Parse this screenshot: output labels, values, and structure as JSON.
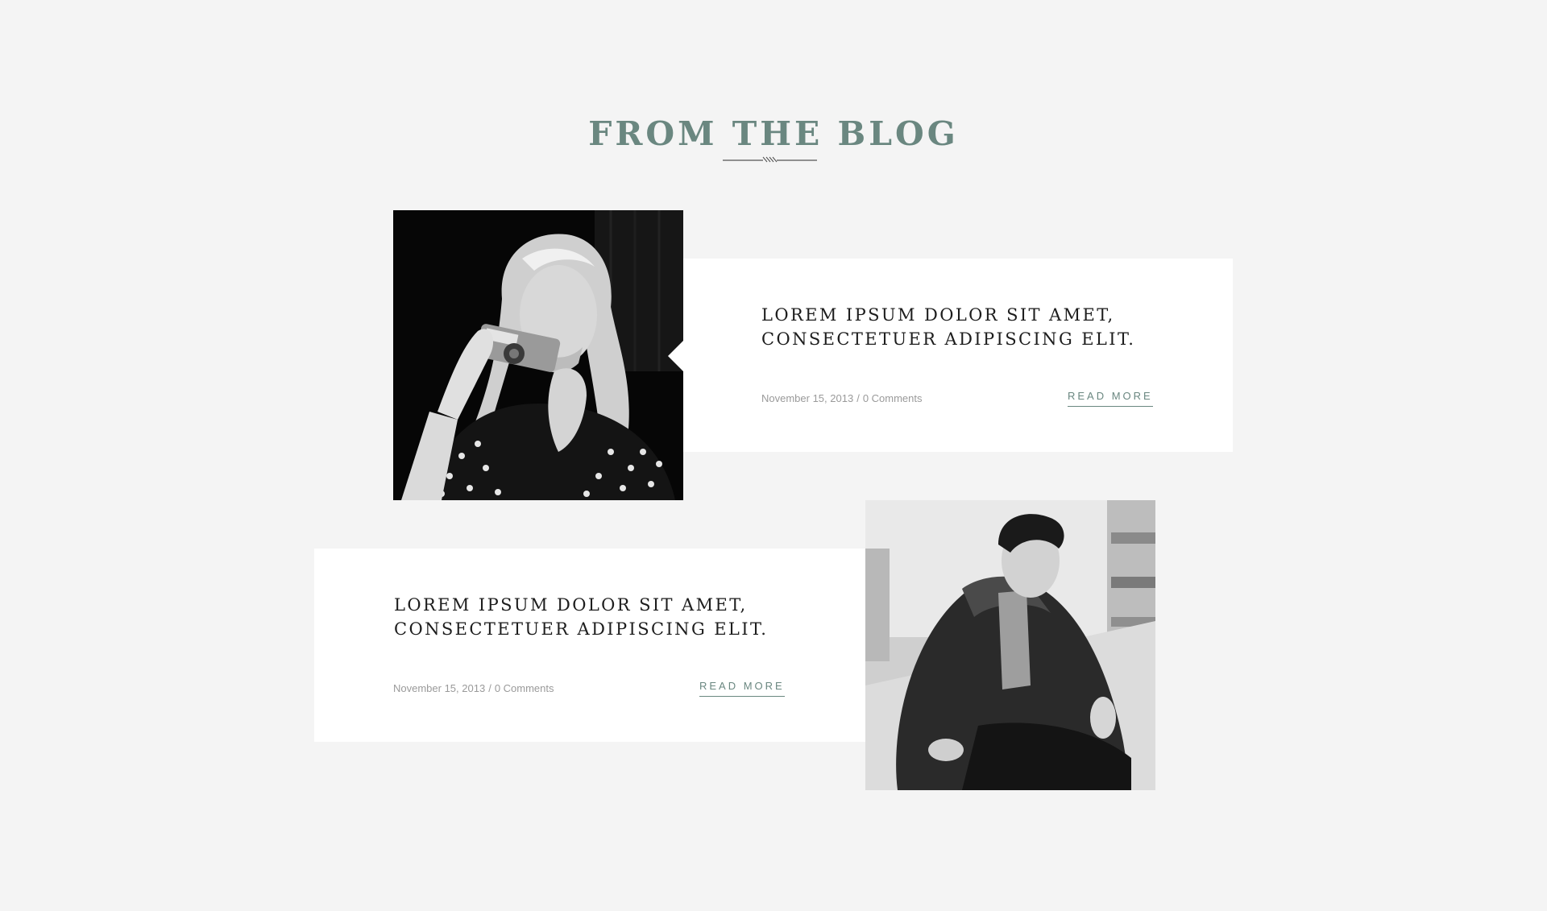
{
  "section": {
    "title": "FROM THE BLOG"
  },
  "posts": [
    {
      "title_line1": "LOREM IPSUM DOLOR SIT AMET,",
      "title_line2": "CONSECTETUER ADIPISCING ELIT.",
      "date": "November 15, 2013",
      "separator": "/",
      "comments": "0 Comments",
      "read_more": "READ MORE",
      "image": "woman-with-camera-photo"
    },
    {
      "title_line1": "LOREM IPSUM DOLOR SIT AMET,",
      "title_line2": "CONSECTETUER ADIPISCING ELIT.",
      "date": "November 15, 2013",
      "separator": "/",
      "comments": "0 Comments",
      "read_more": "READ MORE",
      "image": "man-in-jacket-photo"
    }
  ],
  "colors": {
    "background": "#f4f4f4",
    "card": "#ffffff",
    "accent": "#6a8780",
    "title_text": "#1d1d1d",
    "meta_text": "#9a9a9a"
  }
}
